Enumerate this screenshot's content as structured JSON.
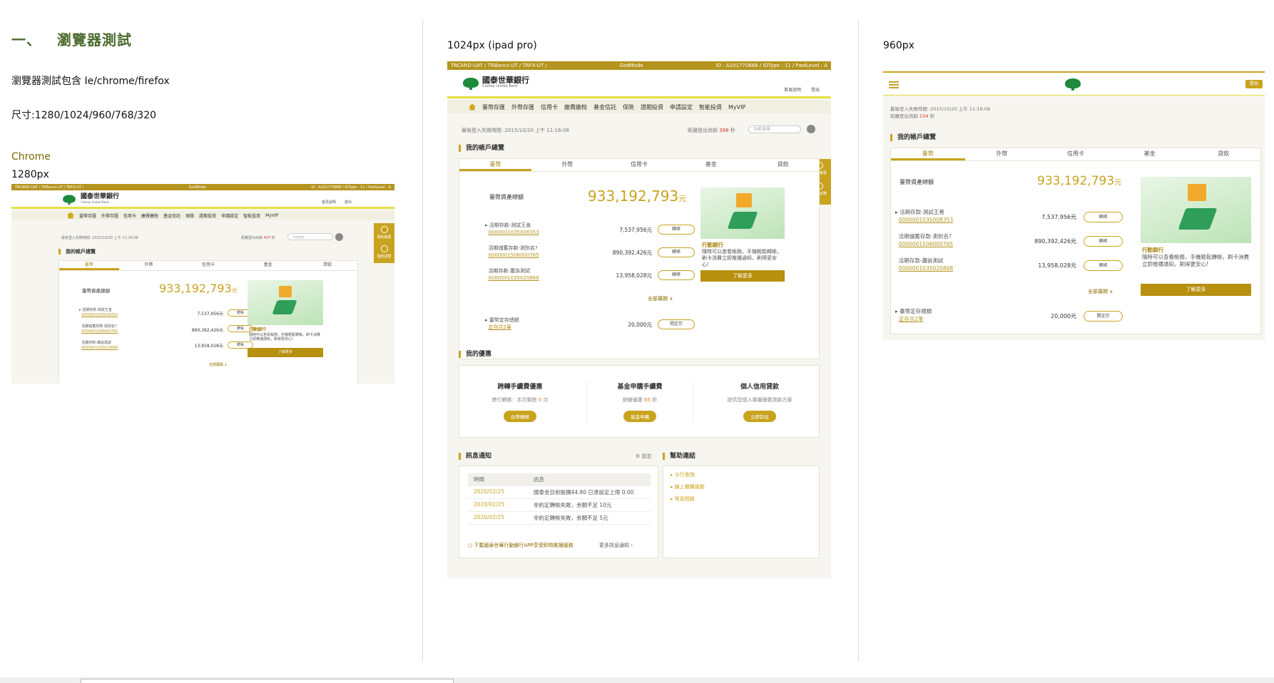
{
  "doc": {
    "section_no": "一、",
    "section_title": "瀏覽器測試",
    "line1": "瀏覽器測試包含 Ie/chrome/firefox",
    "line2": "尺寸:1280/1024/960/768/320",
    "browser": "Chrome",
    "size1": "1280px",
    "size2": "1024px (ipad pro)",
    "size3": "960px"
  },
  "app": {
    "devbar_left": "TRCARD-UAT / TRBancs-UT / TRFX-UT /",
    "devbar_mid": "GodMode",
    "devbar_right": "ID : A101770888 / IDType : 11 / PwdLevel : A",
    "bank_name": "國泰世華銀行",
    "bank_en": "Cathay United Bank",
    "header_links": [
      "首頁說明",
      "登出"
    ],
    "nav": [
      "臺幣存匯",
      "外幣存匯",
      "信用卡",
      "繳費繳稅",
      "基金信託",
      "保險",
      "證期投資",
      "申請設定",
      "智能投資",
      "MyVIP"
    ],
    "last_login": "最後登入失敗時間 :2015/10/20 上午 11:16:08",
    "last_login_short": "最後登入失敗時間 :2015/10/20 上午 11:16:08",
    "logout_countdown": "距離登出尚餘",
    "logout_secs_1280": "437",
    "logout_secs_1024": "388",
    "logout_secs_960": "534",
    "sec_unit": "秒",
    "search_placeholder": "功能搜尋",
    "overview_title": "我的帳戶總覽",
    "tabs": [
      "臺幣",
      "外幣",
      "信用卡",
      "基金",
      "貸款"
    ],
    "asset_label": "臺幣資產總額",
    "asset_value": "933,192,793",
    "asset_unit": "元",
    "accounts": [
      {
        "name": "活期存款-測試王善",
        "no": "0000001035008353",
        "amount": "7,537,956元",
        "btn": "轉帳"
      },
      {
        "name": "活期儲蓄存款-測別名?",
        "no": "0000001506000765",
        "amount": "890,392,426元",
        "btn": "轉帳"
      },
      {
        "name": "活期存款-蕭訴測試",
        "no": "0000001035020868",
        "amount": "13,958,028元",
        "btn": "轉帳"
      }
    ],
    "expand_all": "全部展開",
    "fixed_label": "臺幣定存總額",
    "fixed_link": "定存共2筆",
    "fixed_amount": "20,000元",
    "fixed_btn": "開定存",
    "promo_title": "行動銀行",
    "promo_desc": "隨時可以查看帳務，手機輕鬆轉帳，刷卡消費立即推播通知，刷得更安心!",
    "promo_btn": "了解更多",
    "side_tabs": [
      "我的最愛",
      "還款試算"
    ],
    "offers_title": "我的優惠",
    "offers": [
      {
        "title": "跨轉手續費優惠",
        "sub_pre": "跨行轉帳：本月剩餘",
        "sub_val": "0",
        "sub_post": "次",
        "btn": "台幣轉帳"
      },
      {
        "title": "基金申購手續費",
        "sub_pre": "網銀優惠",
        "sub_val": "65",
        "sub_post": "折",
        "btn": "基金申購"
      },
      {
        "title": "個人信用貸款",
        "sub_pre": "提供您個人專屬優惠貸款方案",
        "sub_val": "",
        "sub_post": "",
        "btn": "立即前往"
      }
    ],
    "msg_title": "訊息通知",
    "msg_setting": "設定",
    "msg_cols": [
      "時間",
      "訊息"
    ],
    "msgs": [
      {
        "date": "2020/02/25",
        "text": "國泰金目前股價44.80 已達設定上限 0.00"
      },
      {
        "date": "2020/02/25",
        "text": "非約定轉帳失敗，余額不足 10元"
      },
      {
        "date": "2020/02/25",
        "text": "非約定轉帳失敗，余額不足 5元"
      }
    ],
    "msg_app": "下載國泰世華行動銀行APP享受即時推播服務",
    "msg_more": "更多訊息通知",
    "help_title": "幫助連結",
    "help_links": [
      "分行查詢",
      "線上櫃檯服務",
      "常見問題"
    ],
    "logout_btn": "登出"
  }
}
